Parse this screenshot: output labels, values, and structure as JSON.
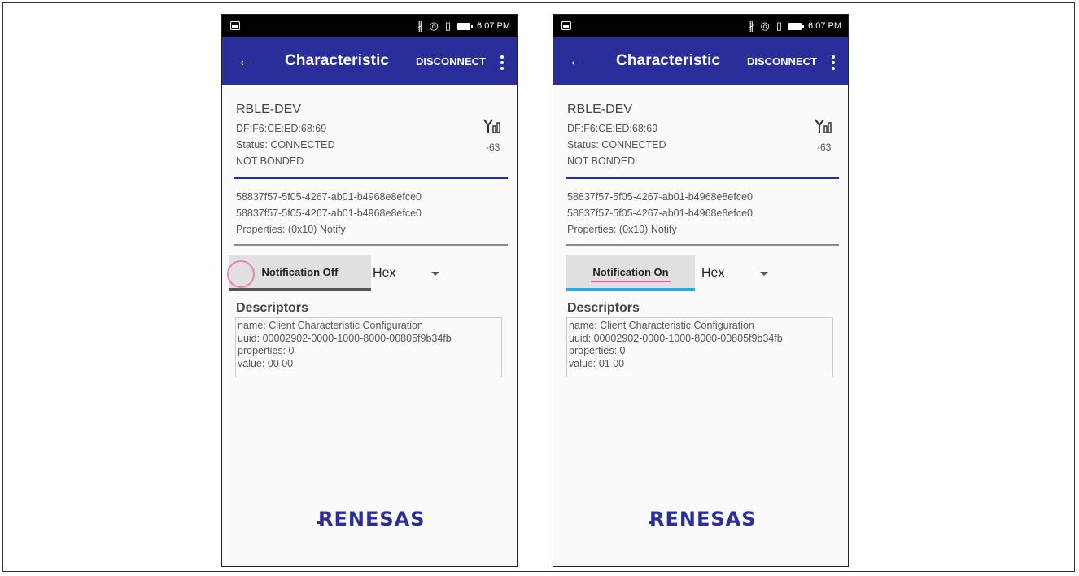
{
  "status_bar": {
    "time": "6:07 PM"
  },
  "app_bar": {
    "title": "Characteristic",
    "disconnect": "DISCONNECT"
  },
  "device": {
    "name": "RBLE-DEV",
    "address": "DF:F6:CE:ED:68:69",
    "status": "Status:  CONNECTED",
    "bond": "NOT BONDED",
    "rssi": "-63"
  },
  "characteristic": {
    "uuid1": "58837f57-5f05-4267-ab01-b4968e8efce0",
    "uuid2": "58837f57-5f05-4267-ab01-b4968e8efce0",
    "properties": "Properties: (0x10) Notify"
  },
  "format_select": {
    "value": "Hex"
  },
  "descriptors": {
    "title": "Descriptors",
    "name": "name: Client Characteristic Configuration",
    "uuid": "uuid: 00002902-0000-1000-8000-00805f9b34fb",
    "properties": "properties: 0"
  },
  "left": {
    "button_label": "Notification Off",
    "value": "value: 00 00"
  },
  "right": {
    "button_label": "Notification On",
    "value": "value: 01 00"
  },
  "brand": {
    "logo_text": "RENESAS",
    "color": "#2a2e9a"
  },
  "colors": {
    "app_bar": "#2a2e9a",
    "notify_on_indicator": "#29a8e0",
    "highlight": "#e8559a"
  }
}
